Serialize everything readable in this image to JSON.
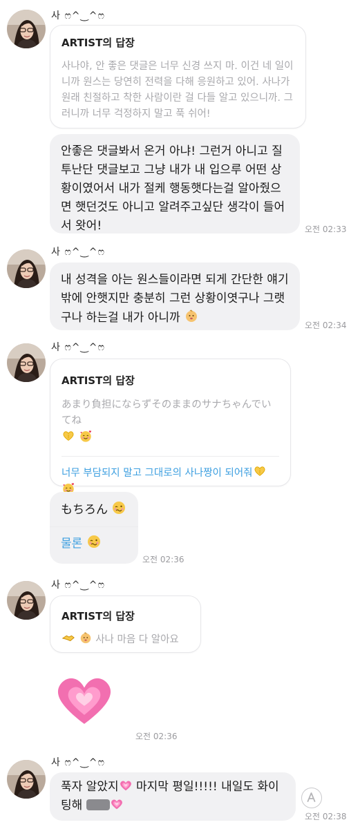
{
  "sender": {
    "name": "사 ෆ^‿^ෆ"
  },
  "reply_label": "ARTIST의 답장",
  "group1": {
    "reply_text": "사나야, 안 좋은 댓글은 너무 신경 쓰지 마. 이건 네 일이니까 원스는 당연히 전력을 다해 응원하고 있어. 사나가 원래 친절하고 착한 사람이란 걸 다들 알고 있으니까. 그러니까 너무 걱정하지 말고 푹 쉬어!",
    "message": "안좋은 댓글봐서 온거 아냐! 그런거 아니고 질투난단 댓글보고 그냥 내가 내 입으루 어떤 상황이였어서 내가 절케 행동햇다는걸 알아줬으면 햇던것도 아니고 알려주고싶단 생각이 들어서 왓어!",
    "time": "오전 02:33"
  },
  "group2": {
    "message": "내 성격을 아는 원스들이라면 되게 간단한 얘기밖에 안햇지만 충분히 그런 상황이엿구나 그랫구나 하는걸 내가 아니까",
    "time": "오전 02:34"
  },
  "group3": {
    "reply_original": "あまり負担にならずそのままのサナちゃんでいてね",
    "reply_translation": "너무 부담되지 말고 그대로의 사나짱이 되어줘",
    "message_original": "もちろん",
    "message_translation": "물론",
    "time": "오전 02:36"
  },
  "group4": {
    "reply_text": "사나 마음 다 알아요",
    "emoji": "growing-heart-emoji",
    "time": "오전 02:36"
  },
  "group5": {
    "message_part1": "푹자 알았지",
    "message_part2": "마지막 평일!!!!! 내일도 화이팅해",
    "time": "오전 02:38"
  },
  "colors": {
    "bubble": "#f1f1f3",
    "translation": "#3d9fe0",
    "muted": "#a9a9ad",
    "heart": "#f05aa8"
  }
}
